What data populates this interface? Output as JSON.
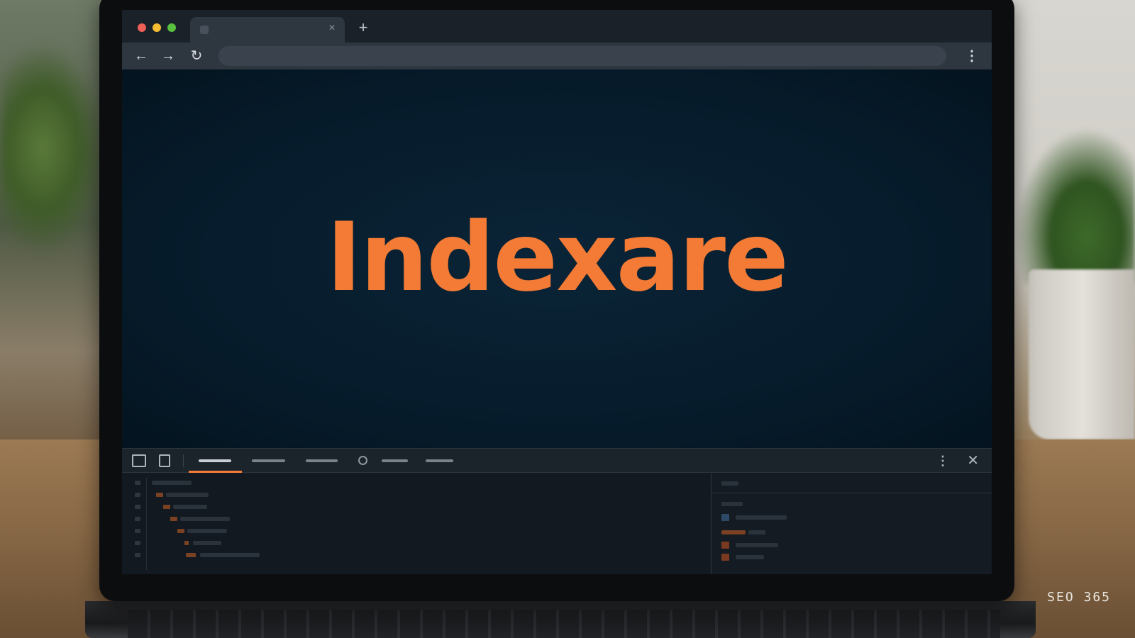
{
  "browser": {
    "tab_title": "",
    "tab_close_glyph": "×",
    "new_tab_glyph": "+",
    "back_glyph": "←",
    "forward_glyph": "→",
    "reload_glyph": "↻",
    "address": "",
    "menu_glyph": "⋮"
  },
  "page": {
    "hero_text": "Indexare",
    "hero_color": "#f47b35",
    "background_color": "#061b2b"
  },
  "devtools": {
    "more_glyph": "⋮",
    "close_glyph": "✕",
    "accent_color": "#f47b35"
  },
  "watermark": {
    "text": "SEO 365"
  },
  "icons": {
    "traffic_lights": [
      "close",
      "minimize",
      "maximize"
    ],
    "devtools_toolbar": [
      "inspect-element-icon",
      "device-toolbar-icon"
    ]
  }
}
